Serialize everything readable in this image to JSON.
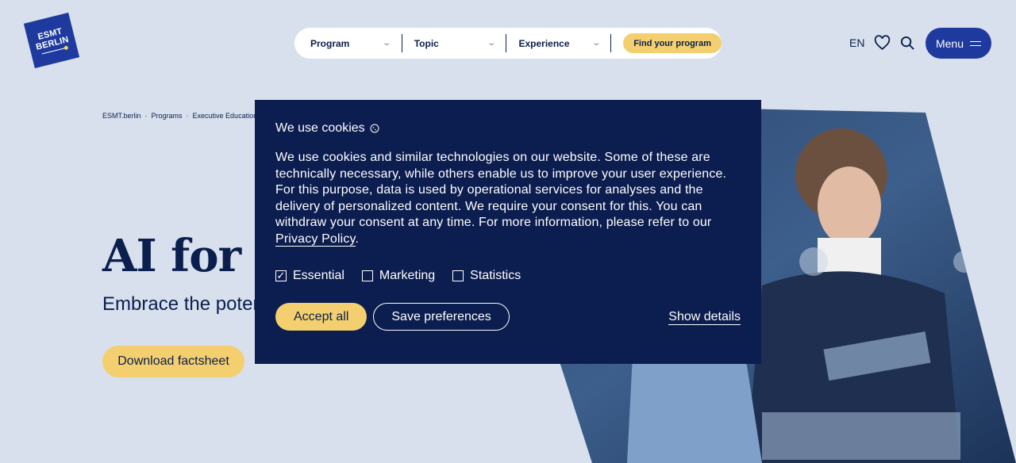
{
  "header": {
    "logo_line1": "ESMT",
    "logo_line2": "BERLIN",
    "finder": {
      "program_label": "Program",
      "topic_label": "Topic",
      "experience_label": "Experience",
      "find_button": "Find your program"
    },
    "language": "EN",
    "menu_label": "Menu"
  },
  "breadcrumb": [
    "ESMT.berlin",
    "·",
    "Programs",
    "·",
    "Executive Education"
  ],
  "hero": {
    "title": "AI for M",
    "subtitle": "Embrace the poten",
    "factsheet_button": "Download factsheet"
  },
  "cookie": {
    "title": "We use cookies",
    "body": "We use cookies and similar technologies on our website. Some of these are technically necessary, while others enable us to improve your user experience. For this purpose, data is used by operational services for analyses and the delivery of personalized content. We require your consent for this. You can withdraw your consent at any time. For more information, please refer to our ",
    "privacy_link": "Privacy Policy",
    "period": ".",
    "options": [
      {
        "label": "Essential",
        "checked": true
      },
      {
        "label": "Marketing",
        "checked": false
      },
      {
        "label": "Statistics",
        "checked": false
      }
    ],
    "accept_all": "Accept all",
    "save_preferences": "Save preferences",
    "show_details": "Show details"
  },
  "colors": {
    "background": "#d8e0ed",
    "navy": "#0c1d4f",
    "brand_blue": "#1e3a9e",
    "accent_yellow": "#f3cf6f"
  }
}
